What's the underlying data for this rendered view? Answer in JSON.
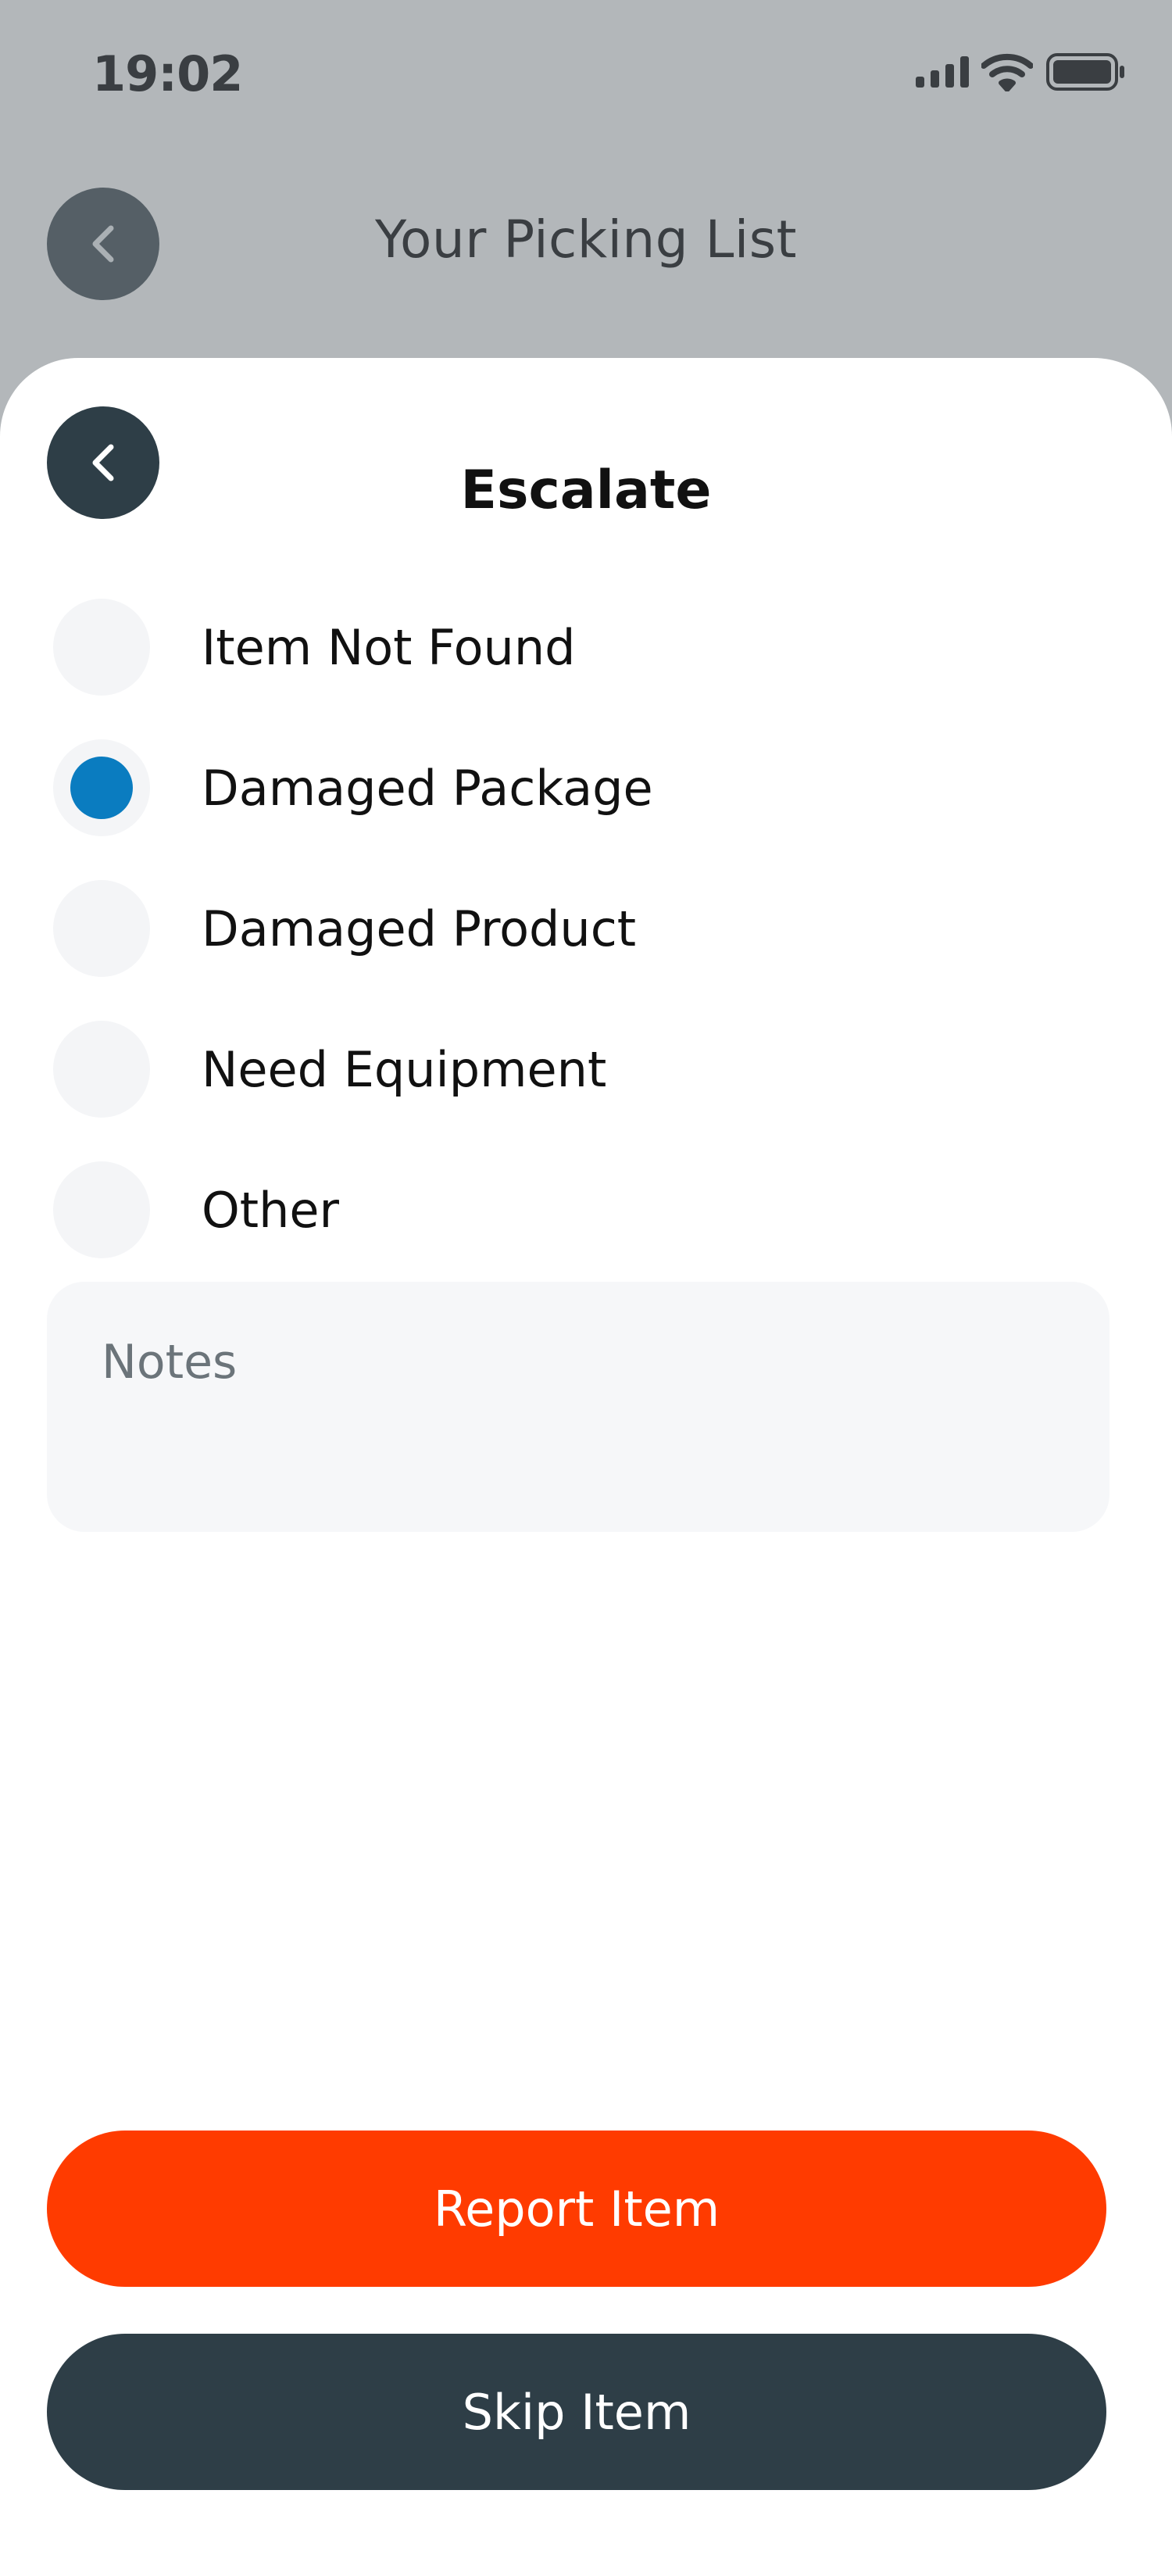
{
  "status_bar": {
    "time": "19:02"
  },
  "background_screen": {
    "title": "Your Picking List"
  },
  "sheet": {
    "title": "Escalate",
    "options": [
      {
        "label": "Item Not Found",
        "selected": false
      },
      {
        "label": "Damaged Package",
        "selected": true
      },
      {
        "label": "Damaged Product",
        "selected": false
      },
      {
        "label": "Need Equipment",
        "selected": false
      },
      {
        "label": "Other",
        "selected": false
      }
    ],
    "notes": {
      "placeholder": "Notes",
      "value": ""
    },
    "report_label": "Report Item",
    "skip_label": "Skip Item"
  },
  "colors": {
    "accent_selected": "#0a7cc0",
    "report_button": "#ff3b00",
    "skip_button": "#2e3e47",
    "overlay_background": "#b3b7ba"
  },
  "icons": {
    "back": "chevron-left-icon",
    "signal": "signal-icon",
    "wifi": "wifi-icon",
    "battery": "battery-icon"
  }
}
